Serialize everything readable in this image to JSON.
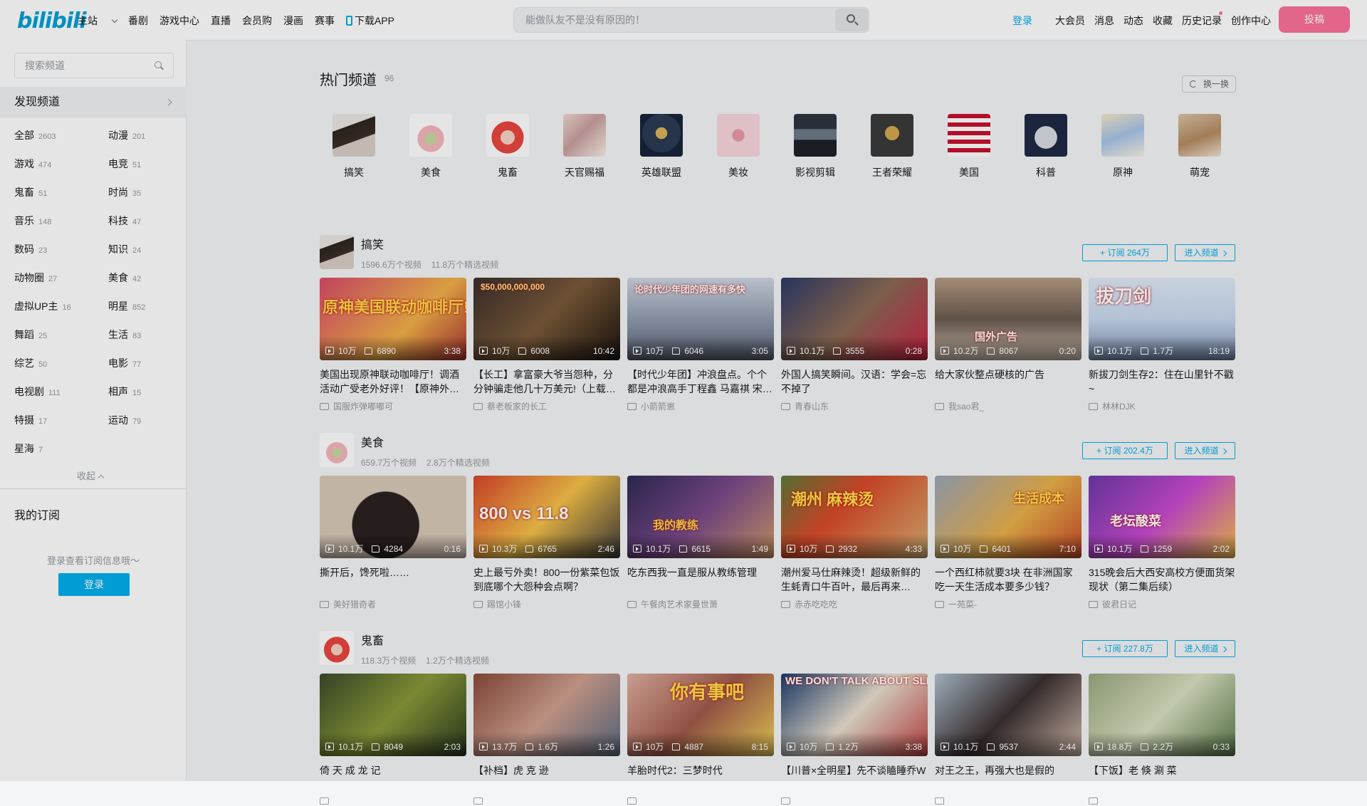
{
  "header": {
    "logo": "bilibili",
    "nav": [
      "主站",
      "番剧",
      "游戏中心",
      "直播",
      "会员购",
      "漫画",
      "赛事"
    ],
    "download": "下载APP",
    "search_placeholder": "能做队友不是没有原因的！",
    "login": "登录",
    "right": [
      "大会员",
      "消息",
      "动态",
      "收藏",
      "历史记录",
      "创作中心"
    ],
    "post": "投稿"
  },
  "sidebar": {
    "search_placeholder": "搜索频道",
    "discover": "发现频道",
    "categories": [
      {
        "name": "全部",
        "count": "2603"
      },
      {
        "name": "动漫",
        "count": "201"
      },
      {
        "name": "游戏",
        "count": "474"
      },
      {
        "name": "电竞",
        "count": "51"
      },
      {
        "name": "鬼畜",
        "count": "51"
      },
      {
        "name": "时尚",
        "count": "35"
      },
      {
        "name": "音乐",
        "count": "148"
      },
      {
        "name": "科技",
        "count": "47"
      },
      {
        "name": "数码",
        "count": "23"
      },
      {
        "name": "知识",
        "count": "24"
      },
      {
        "name": "动物圈",
        "count": "27"
      },
      {
        "name": "美食",
        "count": "42"
      },
      {
        "name": "虚拟UP主",
        "count": "16"
      },
      {
        "name": "明星",
        "count": "852"
      },
      {
        "name": "舞蹈",
        "count": "25"
      },
      {
        "name": "生活",
        "count": "83"
      },
      {
        "name": "综艺",
        "count": "50"
      },
      {
        "name": "电影",
        "count": "77"
      },
      {
        "name": "电视剧",
        "count": "111"
      },
      {
        "name": "相声",
        "count": "15"
      },
      {
        "name": "特摄",
        "count": "17"
      },
      {
        "name": "运动",
        "count": "79"
      },
      {
        "name": "星海",
        "count": "7"
      }
    ],
    "collapse": "收起",
    "my_sub": "我的订阅",
    "login_hint": "登录查看订阅信息哦～",
    "login_btn": "登录"
  },
  "hot": {
    "title": "热门频道",
    "count": "96",
    "refresh": "换一换",
    "channels": [
      "搞笑",
      "美食",
      "鬼畜",
      "天官赐福",
      "英雄联盟",
      "美妆",
      "影视剪辑",
      "王者荣耀",
      "美国",
      "科普",
      "原神",
      "萌宠"
    ]
  },
  "sections": [
    {
      "name": "搞笑",
      "stats": [
        "1596.6万个视频",
        "11.8万个精选视频"
      ],
      "subscribe": "+ 订阅 264万",
      "enter": "进入频道",
      "videos": [
        {
          "views": "10万",
          "likes": "6890",
          "dur": "3:38",
          "title": "美国出现原神联动咖啡厅！调酒活动广受老外好评！【原神外国玩家反应】",
          "up": "国服炸弹嘟嘟可",
          "overlay": "原神美国联动咖啡厅!"
        },
        {
          "views": "10万",
          "likes": "6008",
          "dur": "10:42",
          "title": "【长工】拿富豪大爷当怨种，分分钟骗走他几十万美元!（上载公主的嫁妆）",
          "up": "蔡老板家的长工",
          "overlay": "$50,000,000,000"
        },
        {
          "views": "10万",
          "likes": "6046",
          "dur": "3:05",
          "title": "【时代少年团】冲浪盘点。个个都是冲浪高手丁程鑫 马嘉祺 宋亚轩",
          "up": "小箭箭崽",
          "overlay": "论时代少年团的网速有多快"
        },
        {
          "views": "10.1万",
          "likes": "3555",
          "dur": "0:28",
          "title": "外国人搞笑瞬间。汉语：学会=忘不掉了",
          "up": "青春山东",
          "overlay": ""
        },
        {
          "views": "10.2万",
          "likes": "8067",
          "dur": "0:20",
          "title": "给大家伙整点硬核的广告",
          "up": "我sao君_",
          "overlay": "国外广告"
        },
        {
          "views": "10.1万",
          "likes": "1.7万",
          "dur": "18:19",
          "title": "新拔刀剑生存2：住在山里针不戳~",
          "up": "林林DJK",
          "overlay": "拔刀剑"
        }
      ]
    },
    {
      "name": "美食",
      "stats": [
        "659.7万个视频",
        "2.8万个精选视频"
      ],
      "subscribe": "+ 订阅 202.4万",
      "enter": "进入频道",
      "videos": [
        {
          "views": "10.1万",
          "likes": "4284",
          "dur": "0:16",
          "title": "撕开后，馋死啦……",
          "up": "美好猎奇者",
          "overlay": ""
        },
        {
          "views": "10.3万",
          "likes": "6765",
          "dur": "2:46",
          "title": "史上最亏外卖！800一份紫菜包饭到底哪个大怨种会点啊？",
          "up": "踢馆小锋",
          "overlay": "800 vs 11.8"
        },
        {
          "views": "10.1万",
          "likes": "6615",
          "dur": "1:49",
          "title": "吃东西我一直是服从教练管理",
          "up": "午餐肉艺术家曼世萧",
          "overlay": "我的教练"
        },
        {
          "views": "10万",
          "likes": "2932",
          "dur": "4:33",
          "title": "潮州爱马仕麻辣烫！超级新鲜的生蚝青口牛百叶，最后再来口……",
          "up": "赤赤吃吃吃",
          "overlay": "潮州 麻辣烫"
        },
        {
          "views": "10万",
          "likes": "6401",
          "dur": "7:10",
          "title": "一个西红柿就要3块 在非洲国家吃一天生活成本要多少钱？",
          "up": "一苑菜-",
          "overlay": "生活成本"
        },
        {
          "views": "10.1万",
          "likes": "1259",
          "dur": "2:02",
          "title": "315晚会后大西安高校方便面货架现状（第二集后续）",
          "up": "彼君日记",
          "overlay": "老坛酸菜"
        }
      ]
    },
    {
      "name": "鬼畜",
      "stats": [
        "118.3万个视频",
        "1.2万个精选视频"
      ],
      "subscribe": "+ 订阅 227.8万",
      "enter": "进入频道",
      "videos": [
        {
          "views": "10.1万",
          "likes": "8049",
          "dur": "2:03",
          "title": "倚 天 成 龙 记",
          "up": "",
          "overlay": ""
        },
        {
          "views": "13.7万",
          "likes": "1.6万",
          "dur": "1:26",
          "title": "【补档】虎 克 逊",
          "up": "",
          "overlay": ""
        },
        {
          "views": "10万",
          "likes": "4887",
          "dur": "8:15",
          "title": "羊胎时代2：三梦时代",
          "up": "",
          "overlay": "你有事吧"
        },
        {
          "views": "10万",
          "likes": "1.2万",
          "dur": "3:38",
          "title": "【川普×全明星】先不谈瞌睡乔W",
          "up": "",
          "overlay": "WE DON'T TALK ABOUT SLEEPY JOE"
        },
        {
          "views": "10.1万",
          "likes": "9537",
          "dur": "2:44",
          "title": "对王之王，再强大也是假的",
          "up": "",
          "overlay": ""
        },
        {
          "views": "18.8万",
          "likes": "2.2万",
          "dur": "0:33",
          "title": "【下饭】老 倏 涮 菜",
          "up": "",
          "overlay": ""
        }
      ]
    }
  ]
}
